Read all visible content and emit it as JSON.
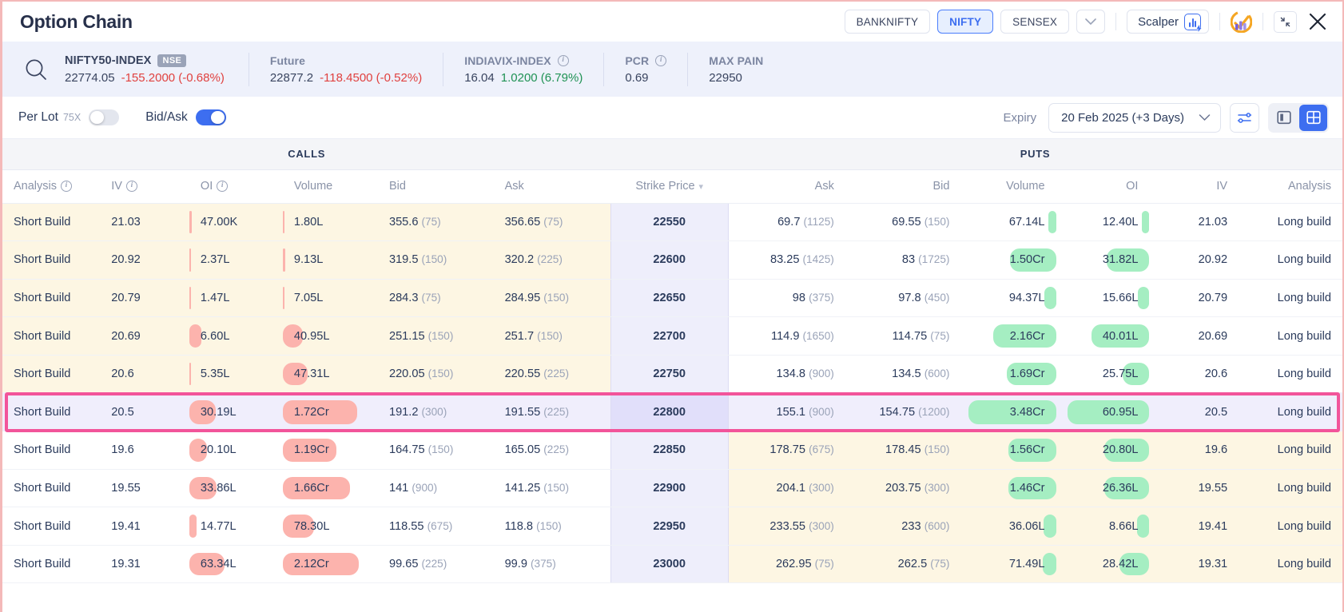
{
  "window": {
    "title": "Option Chain",
    "index_tabs": [
      {
        "label": "BANKNIFTY",
        "active": false
      },
      {
        "label": "NIFTY",
        "active": true
      },
      {
        "label": "SENSEX",
        "active": false
      }
    ],
    "more_caret": "⌄",
    "scalper_label": "Scalper",
    "icons": {
      "scalper": "scalper-icon",
      "brand": "brand-logo-icon",
      "expand": "expand-icon",
      "close": "close-icon",
      "search": "search-icon"
    }
  },
  "index_strip": {
    "search_icon": "search-icon",
    "instrument": {
      "name": "NIFTY50-INDEX",
      "exchange_tag": "NSE",
      "price": "22774.05",
      "change": "-155.2000 (-0.68%)",
      "change_dir": "negative"
    },
    "future": {
      "label": "Future",
      "price": "22877.2",
      "change": "-118.4500 (-0.52%)",
      "change_dir": "negative"
    },
    "vix": {
      "label": "INDIAVIX-INDEX",
      "price": "16.04",
      "change": "1.0200 (6.79%)",
      "change_dir": "positive"
    },
    "pcr": {
      "label": "PCR",
      "value": "0.69"
    },
    "max_pain": {
      "label": "MAX PAIN",
      "value": "22950"
    }
  },
  "controls": {
    "per_lot_label": "Per Lot",
    "per_lot_multiplier": "75X",
    "per_lot_on": false,
    "bid_ask_label": "Bid/Ask",
    "bid_ask_on": true,
    "expiry_label": "Expiry",
    "expiry_value": "20 Feb 2025 (+3 Days)",
    "expiry_caret": "⌄",
    "settings_icon": "sliders-icon",
    "view_split_icon": "split-view-icon",
    "view_grid_icon": "grid-view-icon",
    "view_active": "grid"
  },
  "table": {
    "group_headers": {
      "calls": "CALLS",
      "puts": "PUTS"
    },
    "columns_calls": [
      "Analysis",
      "IV",
      "OI",
      "Volume",
      "Bid",
      "Ask"
    ],
    "columns_strike": "Strike Price",
    "columns_puts": [
      "Ask",
      "Bid",
      "Volume",
      "OI",
      "IV",
      "Analysis"
    ],
    "sort_indicator": "▾",
    "rows": [
      {
        "strike": "22550",
        "highlighted": false,
        "calls_itm": true,
        "puts_itm": false,
        "call": {
          "analysis": "Short Build",
          "iv": "21.03",
          "oi": "47.00K",
          "oi_bar": 3,
          "vol": "1.80L",
          "vol_bar": 2,
          "bid": "355.6",
          "bid_lot": "(75)",
          "ask": "356.65",
          "ask_lot": "(75)"
        },
        "put": {
          "ask": "69.7",
          "ask_lot": "(1125)",
          "bid": "69.55",
          "bid_lot": "(150)",
          "vol": "67.14L",
          "vol_bar": 8,
          "oi": "12.40L",
          "oi_bar": 8,
          "iv": "21.03",
          "analysis": "Long build"
        }
      },
      {
        "strike": "22600",
        "highlighted": false,
        "calls_itm": true,
        "puts_itm": false,
        "call": {
          "analysis": "Short Build",
          "iv": "20.92",
          "oi": "2.37L",
          "oi_bar": 2,
          "vol": "9.13L",
          "vol_bar": 3,
          "bid": "319.5",
          "bid_lot": "(150)",
          "ask": "320.2",
          "ask_lot": "(225)"
        },
        "put": {
          "ask": "83.25",
          "ask_lot": "(1425)",
          "bid": "83",
          "bid_lot": "(1725)",
          "vol": "1.50Cr",
          "vol_bar": 48,
          "oi": "31.82L",
          "oi_bar": 46,
          "iv": "20.92",
          "analysis": "Long build"
        }
      },
      {
        "strike": "22650",
        "highlighted": false,
        "calls_itm": true,
        "puts_itm": false,
        "call": {
          "analysis": "Short Build",
          "iv": "20.79",
          "oi": "1.47L",
          "oi_bar": 2,
          "vol": "7.05L",
          "vol_bar": 2,
          "bid": "284.3",
          "bid_lot": "(75)",
          "ask": "284.95",
          "ask_lot": "(150)"
        },
        "put": {
          "ask": "98",
          "ask_lot": "(375)",
          "bid": "97.8",
          "bid_lot": "(450)",
          "vol": "94.37L",
          "vol_bar": 12,
          "oi": "15.66L",
          "oi_bar": 12,
          "iv": "20.79",
          "analysis": "Long build"
        }
      },
      {
        "strike": "22700",
        "highlighted": false,
        "calls_itm": true,
        "puts_itm": false,
        "call": {
          "analysis": "Short Build",
          "iv": "20.69",
          "oi": "6.60L",
          "oi_bar": 13,
          "vol": "40.95L",
          "vol_bar": 21,
          "bid": "251.15",
          "bid_lot": "(150)",
          "ask": "251.7",
          "ask_lot": "(150)"
        },
        "put": {
          "ask": "114.9",
          "ask_lot": "(1650)",
          "bid": "114.75",
          "bid_lot": "(75)",
          "vol": "2.16Cr",
          "vol_bar": 66,
          "oi": "40.01L",
          "oi_bar": 62,
          "iv": "20.69",
          "analysis": "Long build"
        }
      },
      {
        "strike": "22750",
        "highlighted": false,
        "calls_itm": true,
        "puts_itm": false,
        "call": {
          "analysis": "Short Build",
          "iv": "20.6",
          "oi": "5.35L",
          "oi_bar": 2,
          "vol": "47.31L",
          "vol_bar": 26,
          "bid": "220.05",
          "bid_lot": "(150)",
          "ask": "220.55",
          "ask_lot": "(225)"
        },
        "put": {
          "ask": "134.8",
          "ask_lot": "(900)",
          "bid": "134.5",
          "bid_lot": "(600)",
          "vol": "1.69Cr",
          "vol_bar": 52,
          "oi": "25.75L",
          "oi_bar": 29,
          "iv": "20.6",
          "analysis": "Long build"
        }
      },
      {
        "strike": "22800",
        "highlighted": true,
        "calls_itm": false,
        "puts_itm": false,
        "call": {
          "analysis": "Short Build",
          "iv": "20.5",
          "oi": "30.19L",
          "oi_bar": 28,
          "vol": "1.72Cr",
          "vol_bar": 78,
          "bid": "191.2",
          "bid_lot": "(300)",
          "ask": "191.55",
          "ask_lot": "(225)"
        },
        "put": {
          "ask": "155.1",
          "ask_lot": "(900)",
          "bid": "154.75",
          "bid_lot": "(1200)",
          "vol": "3.48Cr",
          "vol_bar": 92,
          "oi": "60.95L",
          "oi_bar": 88,
          "iv": "20.5",
          "analysis": "Long build"
        }
      },
      {
        "strike": "22850",
        "highlighted": false,
        "calls_itm": false,
        "puts_itm": true,
        "call": {
          "analysis": "Short Build",
          "iv": "19.6",
          "oi": "20.10L",
          "oi_bar": 19,
          "vol": "1.19Cr",
          "vol_bar": 56,
          "bid": "164.75",
          "bid_lot": "(150)",
          "ask": "165.05",
          "ask_lot": "(225)"
        },
        "put": {
          "ask": "178.75",
          "ask_lot": "(675)",
          "bid": "178.45",
          "bid_lot": "(150)",
          "vol": "1.56Cr",
          "vol_bar": 50,
          "oi": "20.80L",
          "oi_bar": 48,
          "iv": "19.6",
          "analysis": "Long build"
        }
      },
      {
        "strike": "22900",
        "highlighted": false,
        "calls_itm": false,
        "puts_itm": true,
        "call": {
          "analysis": "Short Build",
          "iv": "19.55",
          "oi": "33.86L",
          "oi_bar": 29,
          "vol": "1.66Cr",
          "vol_bar": 71,
          "bid": "141",
          "bid_lot": "(900)",
          "ask": "141.25",
          "ask_lot": "(150)"
        },
        "put": {
          "ask": "204.1",
          "ask_lot": "(300)",
          "bid": "203.75",
          "bid_lot": "(300)",
          "vol": "1.46Cr",
          "vol_bar": 50,
          "oi": "26.36L",
          "oi_bar": 48,
          "iv": "19.55",
          "analysis": "Long build"
        }
      },
      {
        "strike": "22950",
        "highlighted": false,
        "calls_itm": false,
        "puts_itm": true,
        "call": {
          "analysis": "Short Build",
          "iv": "19.41",
          "oi": "14.77L",
          "oi_bar": 8,
          "vol": "78.30L",
          "vol_bar": 33,
          "bid": "118.55",
          "bid_lot": "(675)",
          "ask": "118.8",
          "ask_lot": "(150)"
        },
        "put": {
          "ask": "233.55",
          "ask_lot": "(300)",
          "bid": "233",
          "bid_lot": "(600)",
          "vol": "36.06L",
          "vol_bar": 13,
          "oi": "8.66L",
          "oi_bar": 13,
          "iv": "19.41",
          "analysis": "Long build"
        }
      },
      {
        "strike": "23000",
        "highlighted": false,
        "calls_itm": false,
        "puts_itm": true,
        "call": {
          "analysis": "Short Build",
          "iv": "19.31",
          "oi": "63.34L",
          "oi_bar": 38,
          "vol": "2.12Cr",
          "vol_bar": 80,
          "bid": "99.65",
          "bid_lot": "(225)",
          "ask": "99.9",
          "ask_lot": "(375)"
        },
        "put": {
          "ask": "262.95",
          "ask_lot": "(75)",
          "bid": "262.5",
          "bid_lot": "(75)",
          "vol": "71.49L",
          "vol_bar": 14,
          "oi": "28.42L",
          "oi_bar": 32,
          "iv": "19.31",
          "analysis": "Long build"
        }
      }
    ]
  },
  "colors": {
    "accent_blue": "#3d6ef0",
    "highlight_pink": "#f2549a",
    "negative_red": "#e0413f",
    "positive_green": "#1f9254",
    "call_bar_red": "#fcb3ad",
    "put_bar_green": "#a5eec2",
    "itm_bg": "#fdf6e3",
    "strike_bg": "#eeeefb"
  }
}
